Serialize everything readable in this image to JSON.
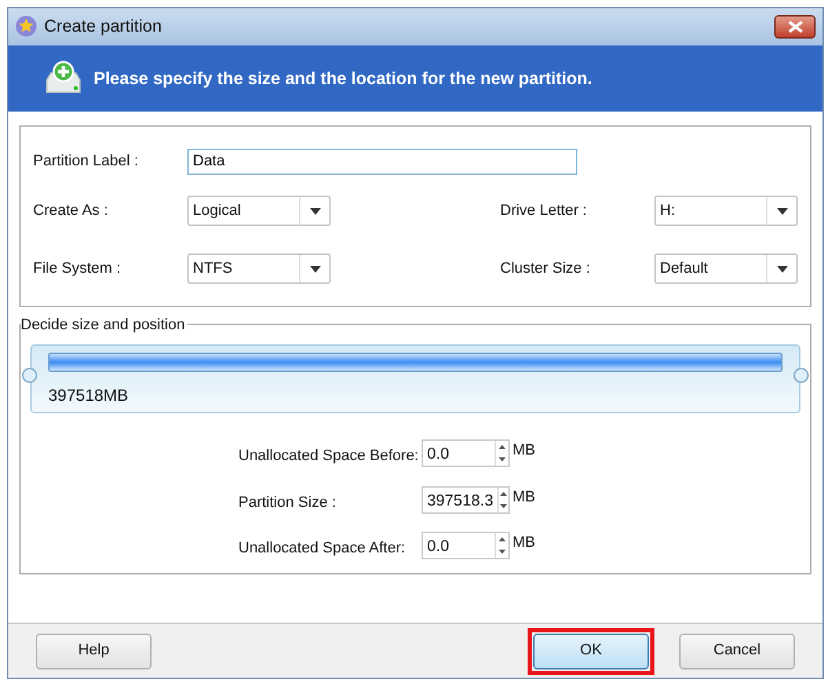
{
  "window": {
    "title": "Create partition"
  },
  "header": {
    "text": "Please specify the size and the location for the new partition."
  },
  "label_field": {
    "label": "Partition Label :",
    "value": "Data"
  },
  "dropdowns": [
    {
      "label": "Create As :",
      "value": "Logical"
    },
    {
      "label": "Drive Letter :",
      "value": "H:"
    },
    {
      "label": "File System :",
      "value": "NTFS"
    },
    {
      "label": "Cluster Size :",
      "value": "Default"
    }
  ],
  "size_group": {
    "legend": "Decide size and position",
    "bar": {
      "text": "397518MB"
    },
    "spinners": [
      {
        "label": "Unallocated Space Before:",
        "value": "0.0",
        "unit": "MB"
      },
      {
        "label": "Partition Size :",
        "value": "397518.3",
        "unit": "MB"
      },
      {
        "label": "Unallocated Space After:",
        "value": "0.0",
        "unit": "MB"
      }
    ]
  },
  "buttons": [
    {
      "label": "Help",
      "highlighted": false,
      "hovered": false
    },
    {
      "label": "OK",
      "highlighted": true,
      "hovered": true
    },
    {
      "label": "Cancel",
      "highlighted": false,
      "hovered": false
    }
  ]
}
